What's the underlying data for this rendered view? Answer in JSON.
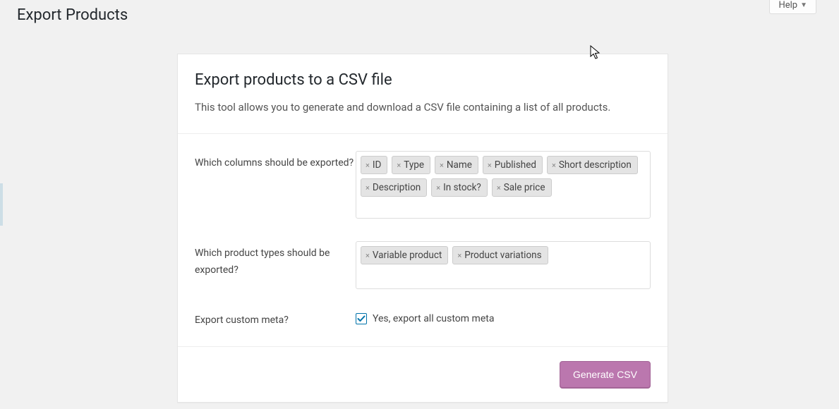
{
  "header": {
    "page_title": "Export Products",
    "help_label": "Help"
  },
  "card": {
    "title": "Export products to a CSV file",
    "description": "This tool allows you to generate and download a CSV file containing a list of all products."
  },
  "form": {
    "columns": {
      "label": "Which columns should be exported?",
      "tags": [
        "ID",
        "Type",
        "Name",
        "Published",
        "Short description",
        "Description",
        "In stock?",
        "Sale price"
      ]
    },
    "types": {
      "label": "Which product types should be exported?",
      "tags": [
        "Variable product",
        "Product variations"
      ]
    },
    "meta": {
      "label": "Export custom meta?",
      "checked": true,
      "checkbox_label": "Yes, export all custom meta"
    }
  },
  "actions": {
    "submit_label": "Generate CSV"
  }
}
